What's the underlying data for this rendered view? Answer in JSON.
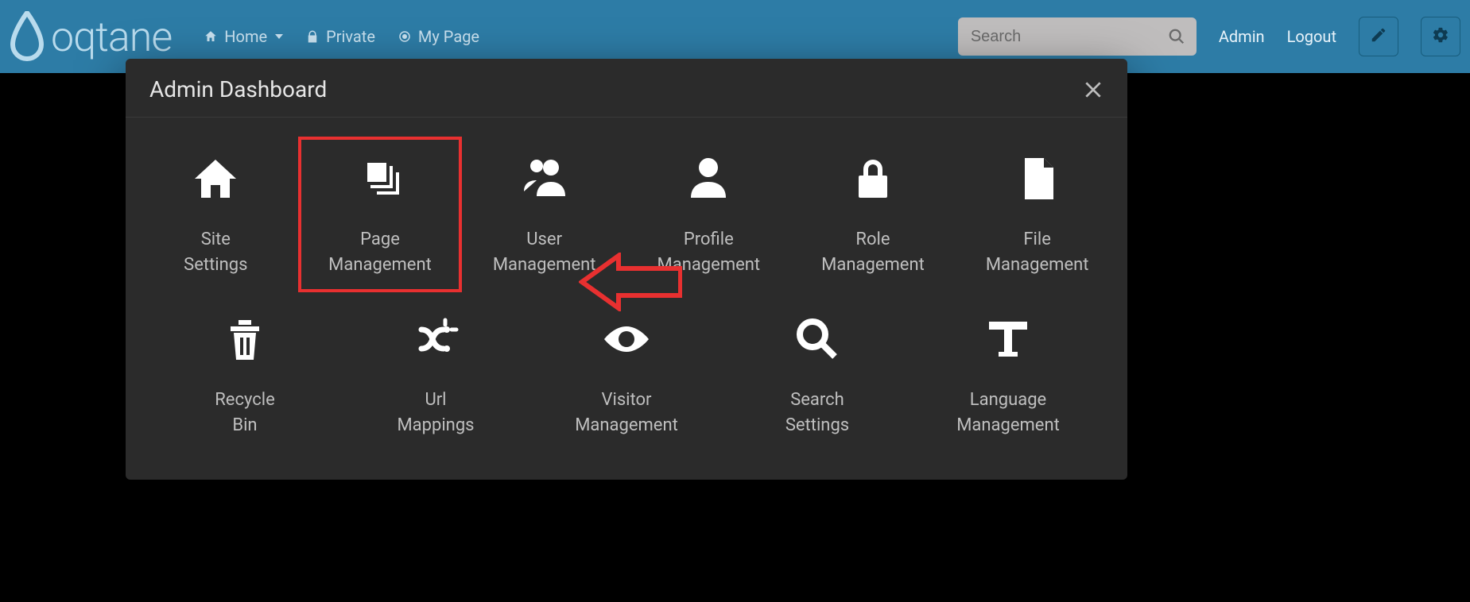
{
  "brand": {
    "name": "oqtane"
  },
  "nav": {
    "items": [
      {
        "label": "Home",
        "icon": "home",
        "caret": true
      },
      {
        "label": "Private",
        "icon": "lock"
      },
      {
        "label": "My Page",
        "icon": "target"
      }
    ],
    "search_placeholder": "Search",
    "admin_label": "Admin",
    "logout_label": "Logout"
  },
  "modal": {
    "title": "Admin Dashboard",
    "highlighted_index": 1,
    "row1": [
      {
        "label": "Site\nSettings",
        "icon": "home-solid"
      },
      {
        "label": "Page\nManagement",
        "icon": "layers"
      },
      {
        "label": "User\nManagement",
        "icon": "users"
      },
      {
        "label": "Profile\nManagement",
        "icon": "person"
      },
      {
        "label": "Role\nManagement",
        "icon": "lock-solid"
      },
      {
        "label": "File\nManagement",
        "icon": "file"
      }
    ],
    "row2": [
      {
        "label": "Recycle\nBin",
        "icon": "trash"
      },
      {
        "label": "Url\nMappings",
        "icon": "random"
      },
      {
        "label": "Visitor\nManagement",
        "icon": "eye"
      },
      {
        "label": "Search\nSettings",
        "icon": "search"
      },
      {
        "label": "Language\nManagement",
        "icon": "type"
      }
    ]
  }
}
